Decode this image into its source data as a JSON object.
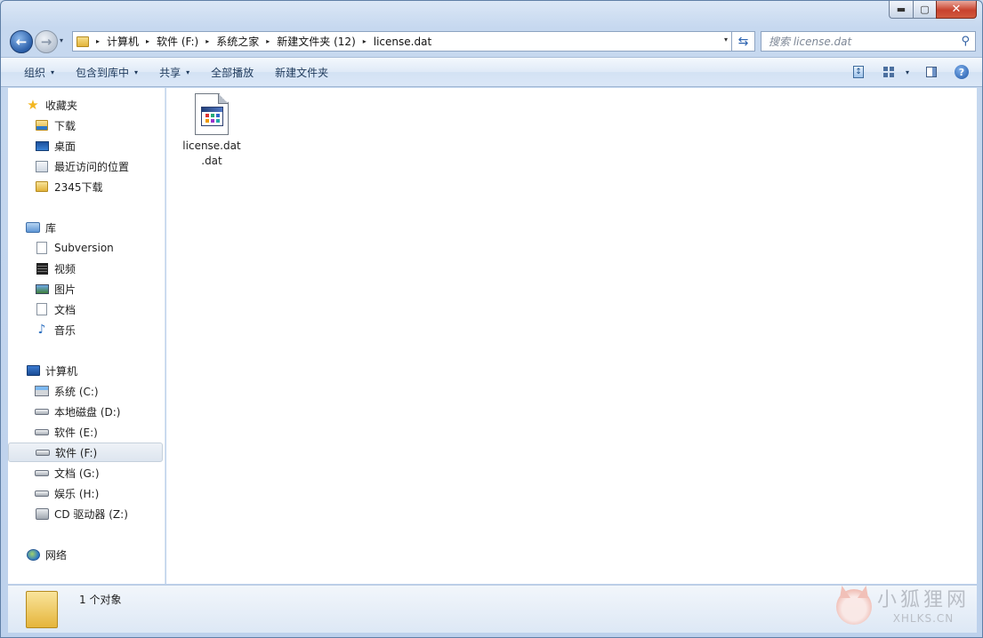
{
  "window": {
    "controls": {
      "minimize": "▬",
      "maximize": "▢",
      "close": "✕"
    }
  },
  "address_bar": {
    "breadcrumbs": [
      "计算机",
      "软件 (F:)",
      "系统之家",
      "新建文件夹 (12)",
      "license.dat"
    ],
    "separator": "▸",
    "dropdown": "▾"
  },
  "search": {
    "placeholder": "搜索 license.dat",
    "icon": "search-icon"
  },
  "toolbar": {
    "organize": "组织",
    "include_in_library": "包含到库中",
    "share": "共享",
    "play_all": "全部播放",
    "new_folder": "新建文件夹",
    "caret": "▾"
  },
  "sidebar": {
    "favorites": {
      "label": "收藏夹",
      "items": [
        "下载",
        "桌面",
        "最近访问的位置",
        "2345下载"
      ]
    },
    "libraries": {
      "label": "库",
      "items": [
        "Subversion",
        "视频",
        "图片",
        "文档",
        "音乐"
      ]
    },
    "computer": {
      "label": "计算机",
      "items": [
        "系统 (C:)",
        "本地磁盘 (D:)",
        "软件 (E:)",
        "软件 (F:)",
        "文档 (G:)",
        "娱乐 (H:)",
        "CD 驱动器 (Z:)"
      ],
      "selected": "软件 (F:)"
    },
    "network": {
      "label": "网络"
    }
  },
  "content": {
    "files": [
      {
        "name": "license.dat\n.dat",
        "line1": "license.dat",
        "line2": ".dat",
        "icon": "application-file-icon"
      }
    ]
  },
  "status": {
    "text": "1 个对象",
    "watermark_cn": "小狐狸网",
    "watermark_en": "XHLKS.CN"
  }
}
